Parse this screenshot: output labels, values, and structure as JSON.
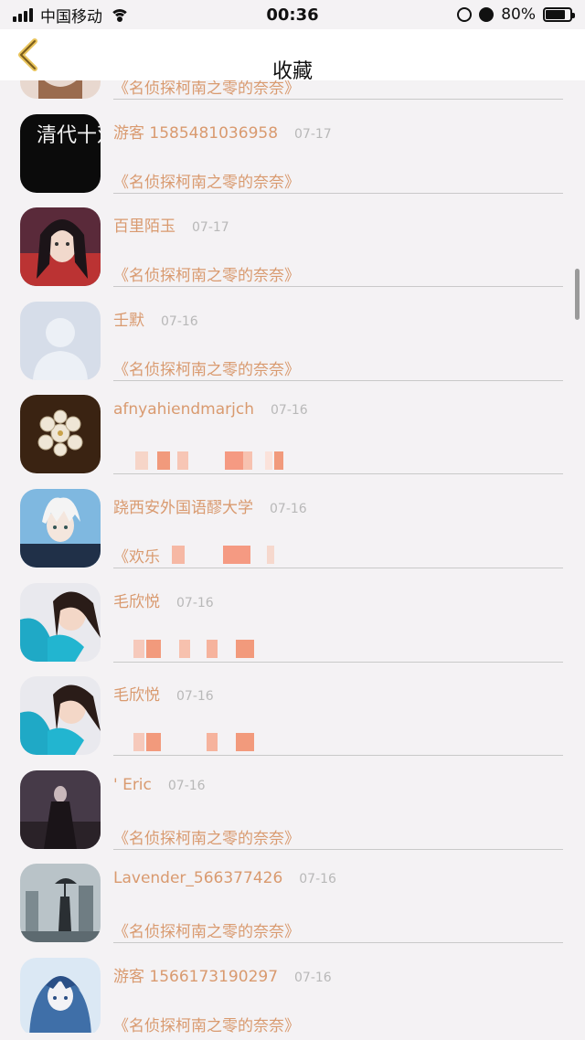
{
  "status_bar": {
    "carrier": "中国移动",
    "time": "00:36",
    "battery": "80%",
    "battery_level": 0.8
  },
  "nav": {
    "title": "收藏"
  },
  "avatar_text": {
    "qingshi": "清代十双杰"
  },
  "items": [
    {
      "name": "",
      "date": "",
      "book": "《名侦探柯南之零的奈奈》",
      "avatar": "partial"
    },
    {
      "name": "游客 1585481036958",
      "date": "07-17",
      "book": "《名侦探柯南之零的奈奈》",
      "avatar": "calligraphy"
    },
    {
      "name": "百里陌玉",
      "date": "07-17",
      "book": "《名侦探柯南之零的奈奈》",
      "avatar": "anime-girl"
    },
    {
      "name": "壬默",
      "date": "07-16",
      "book": "《名侦探柯南之零的奈奈》",
      "avatar": "default"
    },
    {
      "name": "afnyahiendmarjch",
      "date": "07-16",
      "book": "",
      "avatar": "pearls"
    },
    {
      "name": "跷西安外国语醪大学",
      "date": "07-16",
      "book": "《欢乐",
      "avatar": "anime-boy"
    },
    {
      "name": "毛欣悦",
      "date": "07-16",
      "book": "",
      "avatar": "girl-photo"
    },
    {
      "name": "毛欣悦",
      "date": "07-16",
      "book": "",
      "avatar": "girl-photo"
    },
    {
      "name": "' Eric",
      "date": "07-16",
      "book": "《名侦探柯南之零的奈奈》",
      "avatar": "dark-figure"
    },
    {
      "name": "Lavender_566377426",
      "date": "07-16",
      "book": "《名侦探柯南之零的奈奈》",
      "avatar": "rain-city"
    },
    {
      "name": "游客 1566173190297",
      "date": "07-16",
      "book": "《名侦探柯南之零的奈奈》",
      "avatar": "blue-anime"
    }
  ],
  "colors": {
    "accent": "#d99a6f",
    "date": "#b8b8b8",
    "background": "#f4f2f4"
  }
}
